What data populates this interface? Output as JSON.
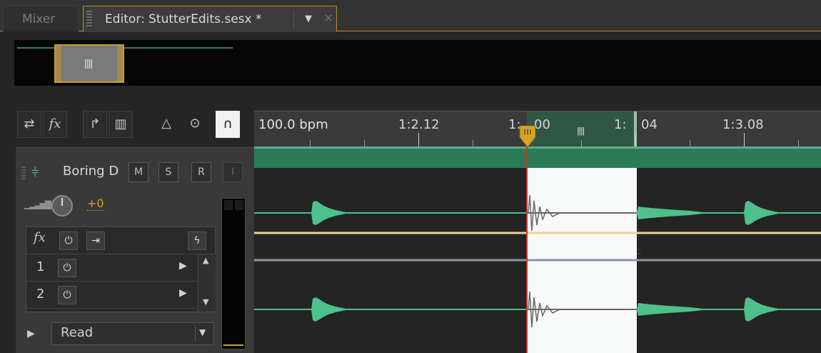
{
  "tabs": {
    "mixer": "Mixer",
    "editor": "Editor: StutterEdits.sesx *",
    "editor_menu_icon": "dropdown-arrow-icon",
    "editor_close_icon": "close-icon"
  },
  "toolbar": {
    "buttons": [
      "swap-arrows-icon",
      "fx-icon",
      "sends-icon",
      "eq-icon",
      "metronome-icon",
      "input-monitor-icon",
      "magnet-snap-icon"
    ],
    "fx_label": "fx"
  },
  "ruler": {
    "tempo": "100.0 bpm",
    "labels": [
      "1:2.12",
      "1:3.00",
      "1:3.04",
      "1:3.08"
    ],
    "label_1": "1:2.12",
    "label_2a": "1:",
    "label_2b": "00",
    "label_3a": "1:",
    "label_3b": "04",
    "label_4": "1:3.08"
  },
  "track": {
    "name": "Boring D",
    "mute": "M",
    "solo": "S",
    "record_arm": "R",
    "input_monitor": "I",
    "volume_value": "+0",
    "fx_label": "fx",
    "slots": [
      {
        "number": "1"
      },
      {
        "number": "2"
      }
    ],
    "automation_mode": "Read"
  },
  "colors": {
    "accent": "#c89a2c",
    "waveform": "#4ec08a",
    "clip_header": "#2c7b58",
    "volume_envelope": "#e8d68a",
    "pan_envelope": "#8a95a6",
    "volume_value": "#d6a226"
  }
}
